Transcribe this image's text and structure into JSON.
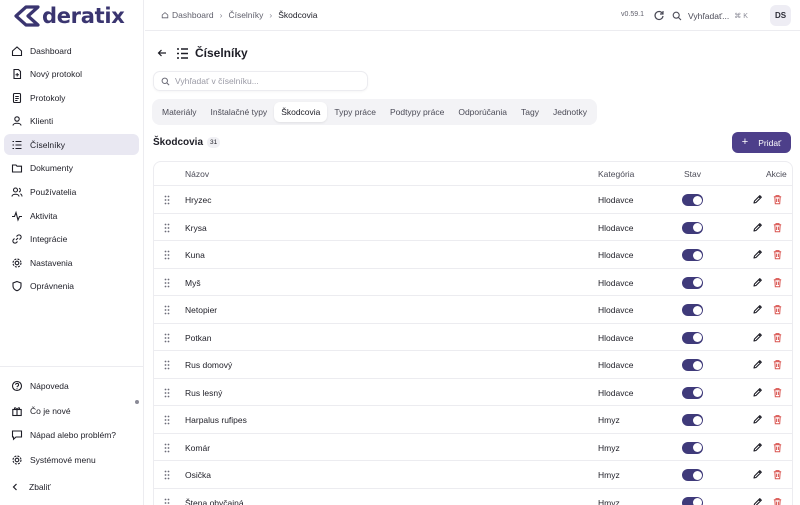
{
  "app": {
    "logo_text": "deratix",
    "version": "v0.59.1"
  },
  "topbar": {
    "breadcrumbs": [
      "Dashboard",
      "Číselníky",
      "Škodcovia"
    ],
    "search_label": "Vyhľadať...",
    "search_shortcut": "⌘ K",
    "avatar_initials": "DS"
  },
  "sidebar": {
    "items": [
      {
        "label": "Dashboard",
        "icon": "home-icon"
      },
      {
        "label": "Nový protokol",
        "icon": "file-plus-icon"
      },
      {
        "label": "Protokoly",
        "icon": "document-icon"
      },
      {
        "label": "Klienti",
        "icon": "user-icon"
      },
      {
        "label": "Číselníky",
        "icon": "list-icon"
      },
      {
        "label": "Dokumenty",
        "icon": "folder-icon"
      },
      {
        "label": "Používatelia",
        "icon": "users-icon"
      },
      {
        "label": "Aktivita",
        "icon": "activity-icon"
      },
      {
        "label": "Integrácie",
        "icon": "link-icon"
      },
      {
        "label": "Nastavenia",
        "icon": "gear-icon"
      },
      {
        "label": "Oprávnenia",
        "icon": "shield-icon"
      }
    ],
    "active_index": 4,
    "bottom": [
      {
        "label": "Nápoveda",
        "icon": "help-icon"
      },
      {
        "label": "Čo je nové",
        "icon": "gift-icon"
      },
      {
        "label": "Nápad alebo problém?",
        "icon": "feedback-icon"
      },
      {
        "label": "Systémové menu",
        "icon": "settings-icon"
      }
    ],
    "collapse_label": "Zbaliť"
  },
  "main": {
    "title": "Číselníky",
    "search_placeholder": "Vyhľadať v číselníku...",
    "tabs": [
      "Materiály",
      "Inštalačné typy",
      "Škodcovia",
      "Typy práce",
      "Podtypy práce",
      "Odporúčania",
      "Tagy",
      "Jednotky"
    ],
    "active_tab": 2,
    "section_title": "Škodcovia",
    "count": "31",
    "add_label": "Pridať",
    "columns": {
      "name": "Názov",
      "category": "Kategória",
      "status": "Stav",
      "actions": "Akcie"
    },
    "rows": [
      {
        "name": "Hryzec",
        "category": "Hlodavce",
        "active": true
      },
      {
        "name": "Krysa",
        "category": "Hlodavce",
        "active": true
      },
      {
        "name": "Kuna",
        "category": "Hlodavce",
        "active": true
      },
      {
        "name": "Myš",
        "category": "Hlodavce",
        "active": true
      },
      {
        "name": "Netopier",
        "category": "Hlodavce",
        "active": true
      },
      {
        "name": "Potkan",
        "category": "Hlodavce",
        "active": true
      },
      {
        "name": "Rus domový",
        "category": "Hlodavce",
        "active": true
      },
      {
        "name": "Rus lesný",
        "category": "Hlodavce",
        "active": true
      },
      {
        "name": "Harpalus rufipes",
        "category": "Hmyz",
        "active": true
      },
      {
        "name": "Komár",
        "category": "Hmyz",
        "active": true
      },
      {
        "name": "Osička",
        "category": "Hmyz",
        "active": true
      },
      {
        "name": "Štena obyčajná",
        "category": "Hmyz",
        "active": true
      }
    ]
  },
  "colors": {
    "accent": "#4d3f8a",
    "toggle_on": "#3f3a7a",
    "delete": "#d9534f",
    "logo": "#3a3570"
  }
}
